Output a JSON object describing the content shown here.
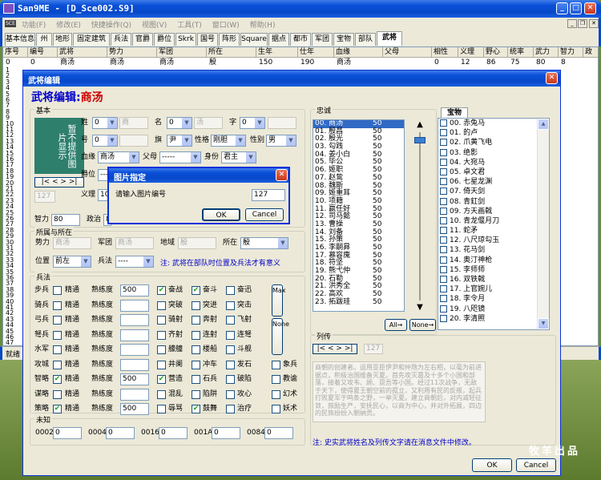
{
  "app": {
    "title": "San9ME - [D_Sce002.S9]",
    "icon": "app-icon"
  },
  "menu": [
    "功能(F)",
    "修改(E)",
    "快捷操作(Q)",
    "视图(V)",
    "工具(T)",
    "窗口(W)",
    "帮助(H)"
  ],
  "tabs": [
    "基本信息",
    "州",
    "地形",
    "固定建筑",
    "兵法",
    "官爵",
    "爵位",
    "Skrk",
    "国号",
    "阵形",
    "Square",
    "据点",
    "都市",
    "军团",
    "宝物",
    "部队",
    "武将"
  ],
  "table": {
    "headers": [
      "序号",
      "编号",
      "武将",
      "势力",
      "军团",
      "所在",
      "生年",
      "仕年",
      "血缘",
      "父母",
      "相性",
      "义理",
      "野心",
      "统率",
      "武力",
      "智力",
      "政"
    ],
    "first_row": [
      "0",
      "0",
      "商汤",
      "商汤",
      "商汤",
      "殷",
      "150",
      "190",
      "商汤",
      "",
      "0",
      "12",
      "86",
      "75",
      "80",
      "8"
    ],
    "row_numbers": [
      "1",
      "2",
      "3",
      "4",
      "5",
      "6",
      "7",
      "8",
      "9",
      "10",
      "11",
      "12",
      "13",
      "14",
      "15",
      "16",
      "17",
      "18",
      "19",
      "20",
      "21",
      "22",
      "23",
      "24",
      "25",
      "26",
      "27",
      "28",
      "29",
      "30",
      "31",
      "32",
      "33",
      "34",
      "35",
      "36",
      "37",
      "38",
      "39",
      "40",
      "41",
      "42",
      "43",
      "44",
      "45",
      "46",
      "47"
    ]
  },
  "status_text": "就绪",
  "dialog": {
    "title": "武将编辑",
    "heading_prefix": "武将编辑:",
    "heading_name": "商汤",
    "basic_label": "基本",
    "portrait_text": "暂不提供图片显示",
    "nav_buttons": "|< < > >|",
    "portrait_index": "127",
    "fields": {
      "surname_label": "姓",
      "surname_sel": "0",
      "surname_val": "商",
      "given_label": "名",
      "given_sel": "0",
      "given_val": "汤",
      "courtesy_label": "字",
      "courtesy_sel": "0",
      "courtesy_val": "",
      "nick_label": "号",
      "nick_sel": "0",
      "banner_label": "旗",
      "banner_sel": "尹",
      "nature_label": "性格",
      "nature_sel": "刚胆",
      "gender_label": "性别",
      "gender_sel": "男",
      "blood_label": "血缘",
      "blood_sel": "商汤",
      "parent_label": "父母",
      "parent_sel": "-----",
      "status_label": "身份",
      "status_sel": "君主",
      "rank_label": "爵位",
      "rank_sel": "----",
      "loyal_label": "义理",
      "loyal_val": "10",
      "int_label": "智力",
      "int_val": "80",
      "pol_label": "政治",
      "pol_val": "8"
    },
    "affiliation": {
      "label": "所属与所在",
      "force_label": "势力",
      "force_val": "商汤",
      "corps_label": "军团",
      "corps_val": "商汤",
      "area_label": "地域",
      "area_val": "殷",
      "loc_label": "所在",
      "loc_sel": "殷",
      "pos_label": "位置",
      "pos_sel": "前左",
      "tactic_label": "兵法",
      "tactic_sel": "----",
      "note": "注: 武将在部队时位置及兵法才有意义"
    },
    "tactics": {
      "label": "兵法",
      "rows": [
        {
          "name": "步兵",
          "checked": false,
          "skill": "精通",
          "exp": "500"
        },
        {
          "name": "骑兵",
          "checked": false,
          "skill": "精通",
          "exp": ""
        },
        {
          "name": "弓兵",
          "checked": false,
          "skill": "精通",
          "exp": ""
        },
        {
          "name": "弩兵",
          "checked": false,
          "skill": "精通",
          "exp": ""
        },
        {
          "name": "水军",
          "checked": false,
          "skill": "精通",
          "exp": ""
        },
        {
          "name": "攻城",
          "checked": false,
          "skill": "精通",
          "exp": ""
        },
        {
          "name": "智略",
          "checked": true,
          "skill": "精通",
          "exp": "500"
        },
        {
          "name": "谋略",
          "checked": false,
          "skill": "精通",
          "exp": ""
        },
        {
          "name": "策略",
          "checked": true,
          "skill": "精通",
          "exp": "500"
        }
      ],
      "exp_label": "熟练度",
      "specials": [
        [
          "奋战",
          true,
          "奋斗",
          true,
          "奋迅",
          false
        ],
        [
          "突破",
          false,
          "突进",
          false,
          "突击",
          false
        ],
        [
          "骑射",
          false,
          "奔射",
          false,
          "飞射",
          false
        ],
        [
          "齐射",
          false,
          "连射",
          false,
          "连弩",
          false
        ],
        [
          "艨艟",
          false,
          "楼船",
          false,
          "斗舰",
          false
        ],
        [
          "井阑",
          false,
          "冲车",
          false,
          "发石",
          false
        ],
        [
          "营造",
          true,
          "石兵",
          false,
          "破陷",
          false
        ],
        [
          "混乱",
          false,
          "陷阱",
          false,
          "攻心",
          false
        ],
        [
          "辱骂",
          false,
          "鼓舞",
          true,
          "治疗",
          false
        ]
      ],
      "extra": [
        [
          "象兵",
          false
        ],
        [
          "教谕",
          false
        ],
        [
          "幻术",
          false
        ],
        [
          "妖术",
          false
        ]
      ],
      "max_btn": "Max",
      "none_btn": "None"
    },
    "unknown": {
      "label": "未知",
      "fields": [
        [
          "0002",
          "0"
        ],
        [
          "0004",
          "0"
        ],
        [
          "0016",
          "0"
        ],
        [
          "001A",
          "0"
        ],
        [
          "0084",
          "0"
        ]
      ]
    },
    "loyalty": {
      "label": "忠诚",
      "items": [
        [
          "00. 商汤",
          "50"
        ],
        [
          "01. 殷昌",
          "50"
        ],
        [
          "02. 殷光",
          "50"
        ],
        [
          "03. 勾践",
          "50"
        ],
        [
          "04. 姜小白",
          "50"
        ],
        [
          "05. 毕公",
          "50"
        ],
        [
          "06. 姬职",
          "50"
        ],
        [
          "07. 赵鸷",
          "50"
        ],
        [
          "08. 魏斯",
          "50"
        ],
        [
          "09. 姬重耳",
          "50"
        ],
        [
          "10. 项籍",
          "50"
        ],
        [
          "11. 嬴任好",
          "50"
        ],
        [
          "12. 司马懿",
          "50"
        ],
        [
          "13. 曹操",
          "50"
        ],
        [
          "14. 刘备",
          "50"
        ],
        [
          "15. 孙策",
          "50"
        ],
        [
          "16. 李嗣昪",
          "50"
        ],
        [
          "17. 慕容廆",
          "50"
        ],
        [
          "18. 符坚",
          "50"
        ],
        [
          "19. 熊弋仲",
          "50"
        ],
        [
          "20. 石勒",
          "50"
        ],
        [
          "21. 洪秀全",
          "50"
        ],
        [
          "22. 高欢",
          "50"
        ],
        [
          "23. 拓跋珪",
          "50"
        ]
      ],
      "all_btn": "All→",
      "none_btn": "None→"
    },
    "treasure": {
      "tab": "宝物",
      "items": [
        "00. 赤兔马",
        "01. 的卢",
        "02. 爪黄飞电",
        "03. 绝影",
        "04. 大宛马",
        "05. 卓文君",
        "06. 七星龙渊",
        "07. 倚天剑",
        "08. 青釭剑",
        "09. 方天画戟",
        "10. 青龙偃月刀",
        "11. 蛇矛",
        "12. 八尺琼勾玉",
        "13. 花马剑",
        "14. 奥汀神枪",
        "15. 李师师",
        "16. 双铁戟",
        "17. 上官婉儿",
        "18. 李令月",
        "19. 八咫镜",
        "20. 李清照"
      ]
    },
    "bio": {
      "label": "列传",
      "index": "127",
      "text": "商朝的创建者。运用亚臣伊尹和仲虺为左右相，以毫为前进据点，积极治国维备灭夏。首先攻灭葛及十多个小国和部落，接着又攻韦、顾、昆吾等小国。经过11次战争，无敌于天下，使得夏王朝空前的孤立，又利用有民的反叛，起兵打败夏军于鸣条之野，一举灭夏。建立商朝后，对内减轻征敛，鼓励生产，安抚民心，以商为中心，并对外拓展，四边的民族纷纷入朝纳贡。",
      "note": "注: 史实武将姓名及列传文字请在消息文件中修改。"
    },
    "ok_btn": "OK",
    "cancel_btn": "Cancel"
  },
  "prompt": {
    "title": "图片指定",
    "label": "请输入图片编号",
    "value": "127",
    "ok_btn": "OK",
    "cancel_btn": "Cancel"
  },
  "watermark": "牧羊出品"
}
